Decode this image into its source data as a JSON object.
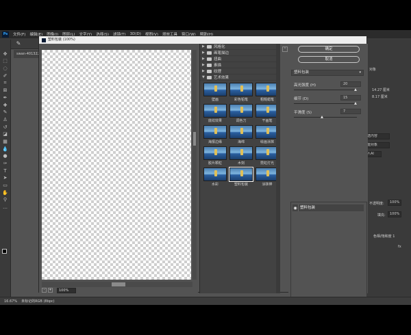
{
  "menubar": {
    "logo": "Ps",
    "items": [
      "文件(F)",
      "编辑(E)",
      "图像(I)",
      "图层(L)",
      "文字(Y)",
      "选择(S)",
      "滤镜(T)",
      "3D(D)",
      "视图(V)",
      "增效工具",
      "窗口(W)",
      "帮助(H)"
    ]
  },
  "document_tab": "swan-401322...",
  "dialog": {
    "title": "塑料包装 (100%)",
    "ok_label": "确定",
    "cancel_label": "取消",
    "zoom": "100%",
    "zoom_minus": "-",
    "zoom_plus": "+"
  },
  "gallery": {
    "collapsed_folders": [
      "风格化",
      "画笔描边",
      "扭曲",
      "素描",
      "纹理"
    ],
    "open_folder": "艺术效果",
    "thumbnails": [
      "壁画",
      "彩色铅笔",
      "粗糙蜡笔",
      "底纹效果",
      "调色刀",
      "干画笔",
      "海报边缘",
      "海绵",
      "绘画涂抹",
      "胶片颗粒",
      "木刻",
      "霓虹灯光",
      "水彩",
      "塑料包装",
      "涂抹棒"
    ],
    "selected": "塑料包装"
  },
  "controls": {
    "selected_filter": "塑料包装",
    "params": [
      {
        "label": "高光强度 (H)",
        "value": "20",
        "fraction": 1.0
      },
      {
        "label": "细节 (D)",
        "value": "15",
        "fraction": 1.0
      },
      {
        "label": "平滑度 (S)",
        "value": "7",
        "fraction": 0.46
      }
    ],
    "layer_name": "塑料包装",
    "visibility_icon": "eye-icon"
  },
  "background_panel": {
    "tab": "对象",
    "val1": "14.27 厘米",
    "val2": "8.17 厘米",
    "content": "选内容",
    "smart": "能对象",
    "ai": "人AI",
    "opacity_label": "不透明度:",
    "opacity": "100%",
    "fill_label": "填充:",
    "fill": "100%",
    "layer_text": "色相/饱和度 1",
    "fx": "fx"
  },
  "status": {
    "zoom": "16.67%",
    "info": "未标记的RGB (8bpc)"
  }
}
